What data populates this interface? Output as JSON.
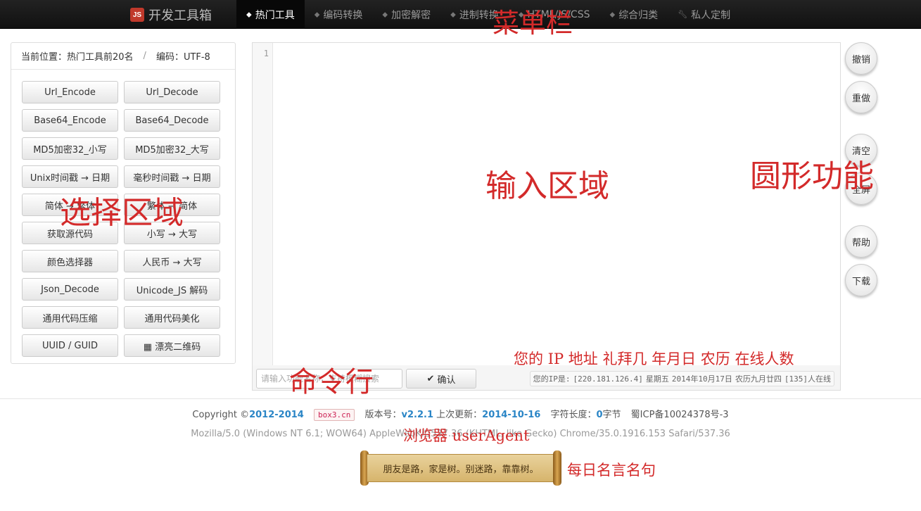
{
  "navbar": {
    "logo_text": "JS",
    "brand": "开发工具箱",
    "items": [
      {
        "label": "热门工具",
        "icon": "tag-icon",
        "active": true
      },
      {
        "label": "编码转换",
        "icon": "tag-icon"
      },
      {
        "label": "加密解密",
        "icon": "tag-icon"
      },
      {
        "label": "进制转换",
        "icon": "tag-icon"
      },
      {
        "label": "HTML/JS/CSS",
        "icon": "tag-icon"
      },
      {
        "label": "综合归类",
        "icon": "tag-icon"
      },
      {
        "label": "私人定制",
        "icon": "wrench-icon"
      }
    ]
  },
  "breadcrumb": {
    "location": "当前位置：热门工具前20名",
    "separator": "/",
    "encoding": "编码：UTF-8"
  },
  "tools": [
    "Url_Encode",
    "Url_Decode",
    "Base64_Encode",
    "Base64_Decode",
    "MD5加密32_小写",
    "MD5加密32_大写",
    "Unix时间戳 → 日期",
    "毫秒时间戳 → 日期",
    "简体 → 繁体",
    "繁体 → 简体",
    "获取源代码",
    "小写 → 大写",
    "颜色选择器",
    "人民币 → 大写",
    "Json_Decode",
    "Unicode_JS 解码",
    "通用代码压缩",
    "通用代码美化",
    "UUID / GUID",
    "▦ 漂亮二维码"
  ],
  "editor": {
    "line_number": "1"
  },
  "command": {
    "placeholder": "请输入功能名称，支持模糊搜索",
    "confirm_icon": "✔",
    "confirm_label": "确认",
    "ip_label": "您的IP是:",
    "ip": "[220.181.126.4]",
    "weekday": "星期五",
    "date": "2014年10月17日",
    "lunar": "农历九月廿四",
    "online": "[135]人在线"
  },
  "round_buttons": {
    "undo": "撤销",
    "redo": "重做",
    "clear": "清空",
    "fullscreen": "全屏",
    "help": "帮助",
    "download": "下载"
  },
  "footer": {
    "copyright_prefix": "Copyright ©",
    "years": "2012-2014",
    "domain": "box3.cn",
    "version_label": "版本号：",
    "version": "v2.2.1",
    "updated_label": "上次更新：",
    "updated": "2014-10-16",
    "length_label": "字符长度：",
    "length": "0",
    "length_unit": "字节",
    "icp": "蜀ICP备10024378号-3",
    "user_agent": "Mozilla/5.0 (Windows NT 6.1; WOW64) AppleWebKit/537.36 (KHTML, like Gecko) Chrome/35.0.1916.153 Safari/537.36",
    "quote": "朋友是路，家是树。别迷路，靠靠树。"
  },
  "annotations": {
    "menu_bar": "菜单栏",
    "select_area": "选择区域",
    "input_area": "输入区域",
    "round_functions": "圆形功能",
    "info_note": "您的 IP 地址 礼拜几  年月日  农历  在线人数",
    "command_line": "命令行",
    "user_agent": "浏览器 userAgent",
    "daily_quote": "每日名言名句"
  },
  "colors": {
    "accent": "#2a85c6",
    "annotation": "#d32a2a",
    "navbar": "#1b1b1b"
  }
}
